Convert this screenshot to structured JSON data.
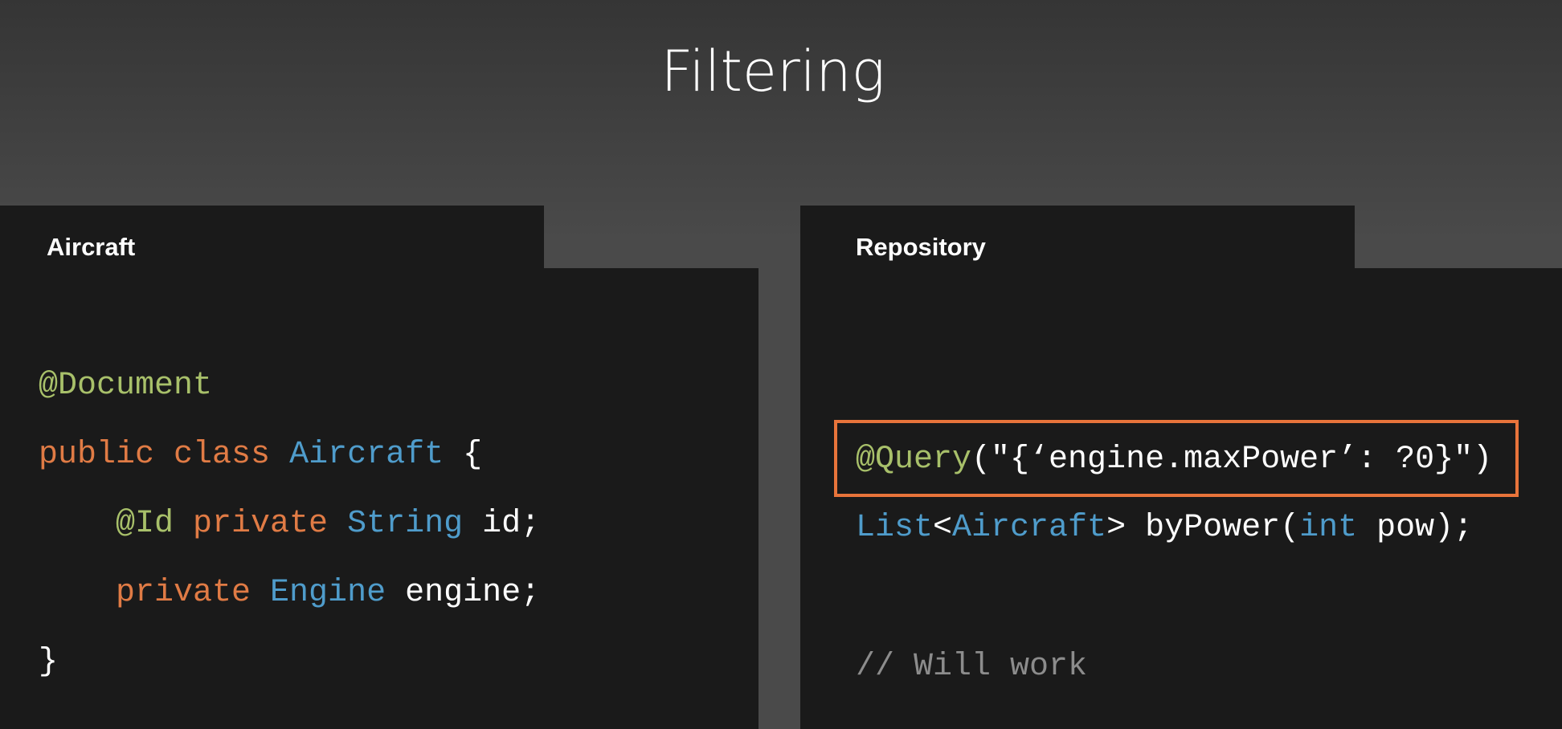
{
  "title": "Filtering",
  "left_panel": {
    "label": "Aircraft",
    "lines": [
      [
        {
          "t": "@Document",
          "c": "green"
        }
      ],
      [
        {
          "t": "public class ",
          "c": "orange"
        },
        {
          "t": "Aircraft",
          "c": "blue"
        },
        {
          "t": " {",
          "c": "white"
        }
      ],
      [
        {
          "t": "    @Id ",
          "c": "green"
        },
        {
          "t": "private ",
          "c": "orange"
        },
        {
          "t": "String",
          "c": "blue"
        },
        {
          "t": " id;",
          "c": "white"
        }
      ],
      [
        {
          "t": "    private ",
          "c": "orange"
        },
        {
          "t": "Engine",
          "c": "blue"
        },
        {
          "t": " engine;",
          "c": "white"
        }
      ],
      [
        {
          "t": "}",
          "c": "white"
        }
      ]
    ]
  },
  "right_panel": {
    "label": "Repository",
    "lines": [
      [
        {
          "t": "@Query",
          "c": "green"
        },
        {
          "t": "(\"{‘engine.maxPower’: ?0}\")",
          "c": "white"
        }
      ],
      [
        {
          "t": "List",
          "c": "blue"
        },
        {
          "t": "<",
          "c": "white"
        },
        {
          "t": "Aircraft",
          "c": "blue"
        },
        {
          "t": "> byPower(",
          "c": "white"
        },
        {
          "t": "int",
          "c": "blue"
        },
        {
          "t": " pow);",
          "c": "white"
        }
      ],
      [
        {
          "t": "// Will work",
          "c": "gray"
        }
      ]
    ],
    "highlight_color": "#e8743b"
  }
}
